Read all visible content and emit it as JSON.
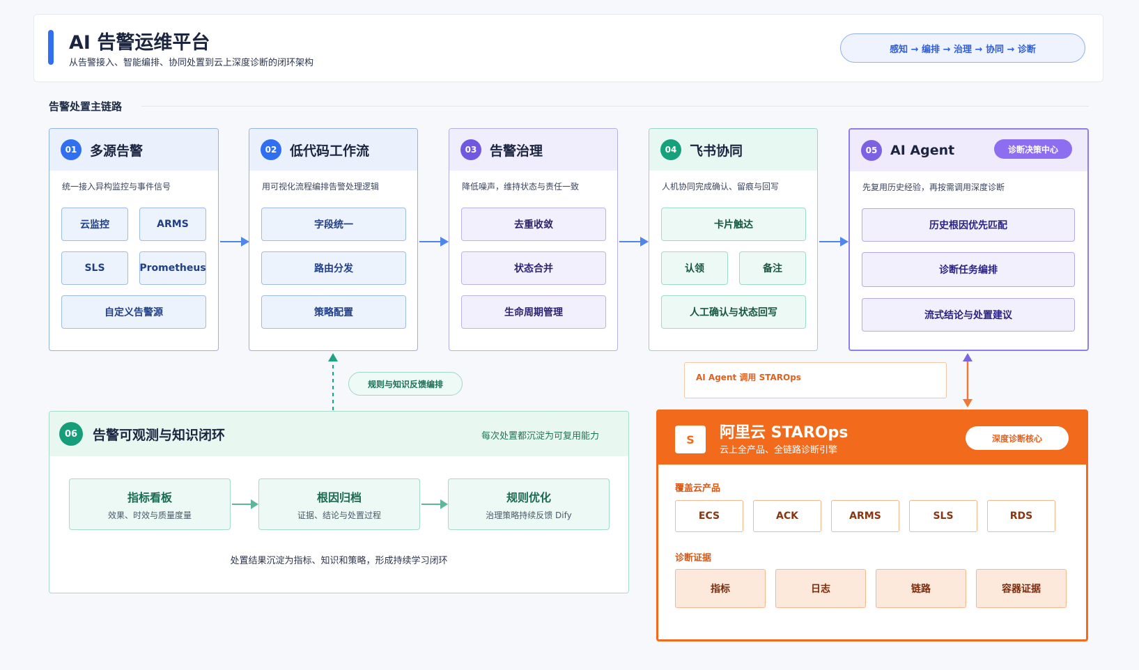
{
  "header": {
    "title": "AI 告警运维平台",
    "subtitle": "从告警接入、智能编排、协同处置到云上深度诊断的闭环架构",
    "flow_pill": "感知 → 编排 → 治理 → 协同 → 诊断"
  },
  "main_chain": {
    "title": "告警处置主链路",
    "cards": [
      {
        "num": "01",
        "title": "多源告警",
        "desc": "统一接入异构监控与事件信号",
        "items": [
          "云监控",
          "ARMS",
          "SLS",
          "Prometheus",
          "自定义告警源"
        ]
      },
      {
        "num": "02",
        "title": "低代码工作流",
        "desc": "用可视化流程编排告警处理逻辑",
        "items": [
          "字段统一",
          "路由分发",
          "策略配置"
        ]
      },
      {
        "num": "03",
        "title": "告警治理",
        "desc": "降低噪声，维持状态与责任一致",
        "items": [
          "去重收敛",
          "状态合并",
          "生命周期管理"
        ]
      },
      {
        "num": "04",
        "title": "飞书协同",
        "desc": "人机协同完成确认、留痕与回写",
        "items": [
          "卡片触达",
          "认领",
          "备注",
          "人工确认与状态回写"
        ]
      },
      {
        "num": "05",
        "title": "AI Agent",
        "badge": "诊断决策中心",
        "desc": "先复用历史经验，再按需调用深度诊断",
        "items": [
          "历史根因优先匹配",
          "诊断任务编排",
          "流式结论与处置建议"
        ]
      }
    ]
  },
  "feedback_label": "规则与知识反馈编排",
  "agent_call_label": "AI Agent 调用 STAROps",
  "knowledge_loop": {
    "num": "06",
    "title": "告警可观测与知识闭环",
    "right_note": "每次处置都沉淀为可复用能力",
    "boxes": [
      {
        "title": "指标看板",
        "sub": "效果、时效与质量度量"
      },
      {
        "title": "根因归档",
        "sub": "证据、结论与处置过程"
      },
      {
        "title": "规则优化",
        "sub": "治理策略持续反馈 Dify"
      }
    ],
    "footer": "处置结果沉淀为指标、知识和策略，形成持续学习闭环"
  },
  "starops": {
    "logo": "S",
    "title": "阿里云 STAROps",
    "subtitle": "云上全产品、全链路诊断引擎",
    "badge": "深度诊断核心",
    "products_label": "覆盖云产品",
    "products": [
      "ECS",
      "ACK",
      "ARMS",
      "SLS",
      "RDS"
    ],
    "evidence_label": "诊断证据",
    "evidence": [
      "指标",
      "日志",
      "链路",
      "容器证据"
    ]
  },
  "colors": {
    "blue": "#2f6ff0",
    "purple": "#7058e0",
    "green": "#16a07c",
    "agent_purple": "#8e6ef0",
    "orange": "#f26a1c"
  }
}
